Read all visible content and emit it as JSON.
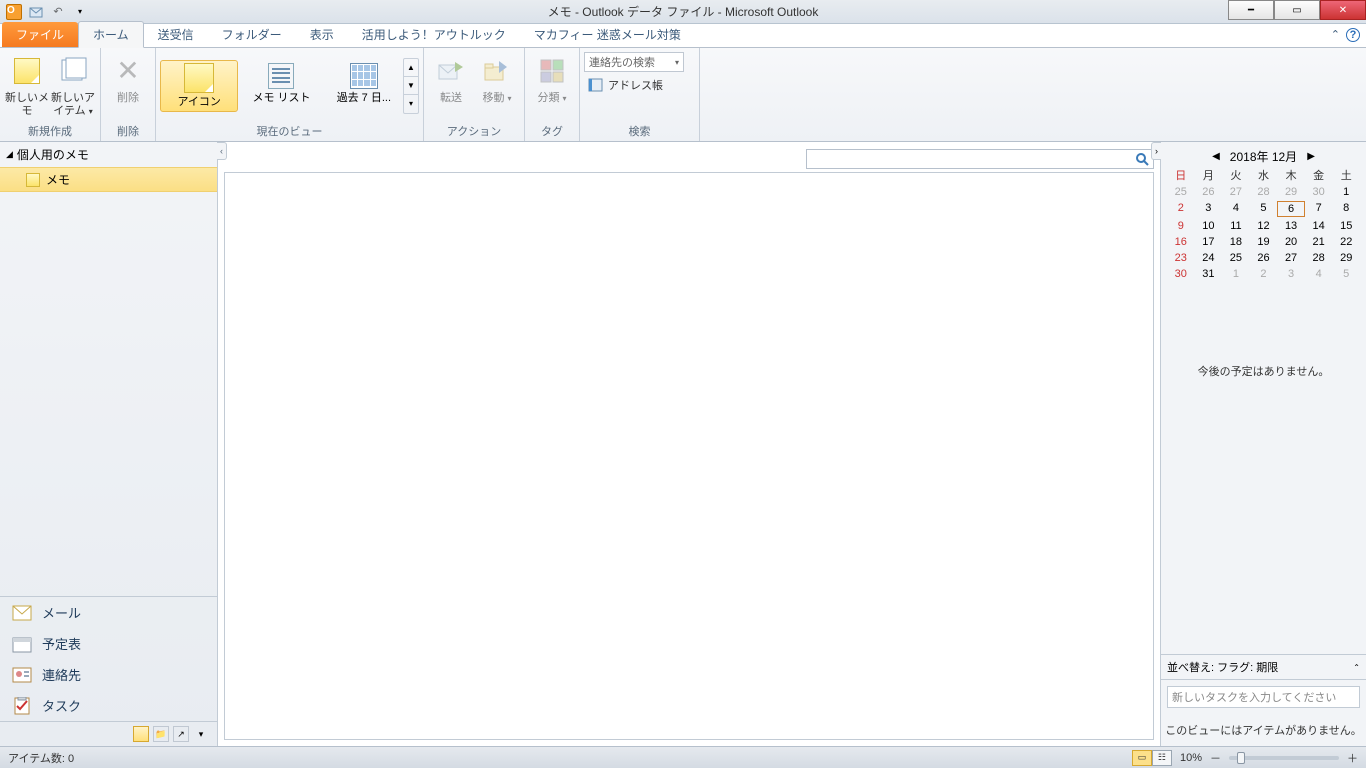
{
  "window": {
    "title": "メモ - Outlook データ ファイル - Microsoft Outlook"
  },
  "tabs": {
    "file": "ファイル",
    "items": [
      "ホーム",
      "送受信",
      "フォルダー",
      "表示",
      "活用しよう！アウトルック",
      "マカフィー 迷惑メール対策"
    ],
    "active": 0
  },
  "ribbon": {
    "new_group": "新規作成",
    "new_memo": "新しいメモ",
    "new_item": "新しいアイテム",
    "delete_group": "削除",
    "delete": "削除",
    "view_group": "現在のビュー",
    "view_icon": "アイコン",
    "view_list": "メモ リスト",
    "view_week": "過去 7 日...",
    "actions_group": "アクション",
    "forward": "転送",
    "move": "移動",
    "tag_group": "タグ",
    "categorize": "分類",
    "search_group": "検索",
    "search_contacts": "連絡先の検索",
    "address_book": "アドレス帳"
  },
  "folder": {
    "root": "個人用のメモ",
    "memo": "メモ"
  },
  "nav": {
    "mail": "メール",
    "calendar": "予定表",
    "contacts": "連絡先",
    "tasks": "タスク"
  },
  "calendar": {
    "title": "2018年 12月",
    "dow": [
      "日",
      "月",
      "火",
      "水",
      "木",
      "金",
      "土"
    ],
    "cells": [
      {
        "n": "25",
        "dim": true
      },
      {
        "n": "26",
        "dim": true
      },
      {
        "n": "27",
        "dim": true
      },
      {
        "n": "28",
        "dim": true
      },
      {
        "n": "29",
        "dim": true
      },
      {
        "n": "30",
        "dim": true
      },
      {
        "n": "1"
      },
      {
        "n": "2",
        "red": true
      },
      {
        "n": "3"
      },
      {
        "n": "4"
      },
      {
        "n": "5"
      },
      {
        "n": "6",
        "today": true
      },
      {
        "n": "7"
      },
      {
        "n": "8"
      },
      {
        "n": "9",
        "red": true
      },
      {
        "n": "10"
      },
      {
        "n": "11"
      },
      {
        "n": "12"
      },
      {
        "n": "13"
      },
      {
        "n": "14"
      },
      {
        "n": "15"
      },
      {
        "n": "16",
        "red": true
      },
      {
        "n": "17"
      },
      {
        "n": "18"
      },
      {
        "n": "19"
      },
      {
        "n": "20"
      },
      {
        "n": "21"
      },
      {
        "n": "22"
      },
      {
        "n": "23",
        "red": true
      },
      {
        "n": "24"
      },
      {
        "n": "25"
      },
      {
        "n": "26"
      },
      {
        "n": "27"
      },
      {
        "n": "28"
      },
      {
        "n": "29"
      },
      {
        "n": "30",
        "red": true
      },
      {
        "n": "31"
      },
      {
        "n": "1",
        "dim": true
      },
      {
        "n": "2",
        "dim": true
      },
      {
        "n": "3",
        "dim": true
      },
      {
        "n": "4",
        "dim": true
      },
      {
        "n": "5",
        "dim": true
      }
    ],
    "no_appt": "今後の予定はありません。"
  },
  "tasks": {
    "sort": "並べ替え: フラグ: 期限",
    "placeholder": "新しいタスクを入力してください",
    "empty": "このビューにはアイテムがありません。"
  },
  "status": {
    "items": "アイテム数: 0",
    "zoom": "10%"
  }
}
